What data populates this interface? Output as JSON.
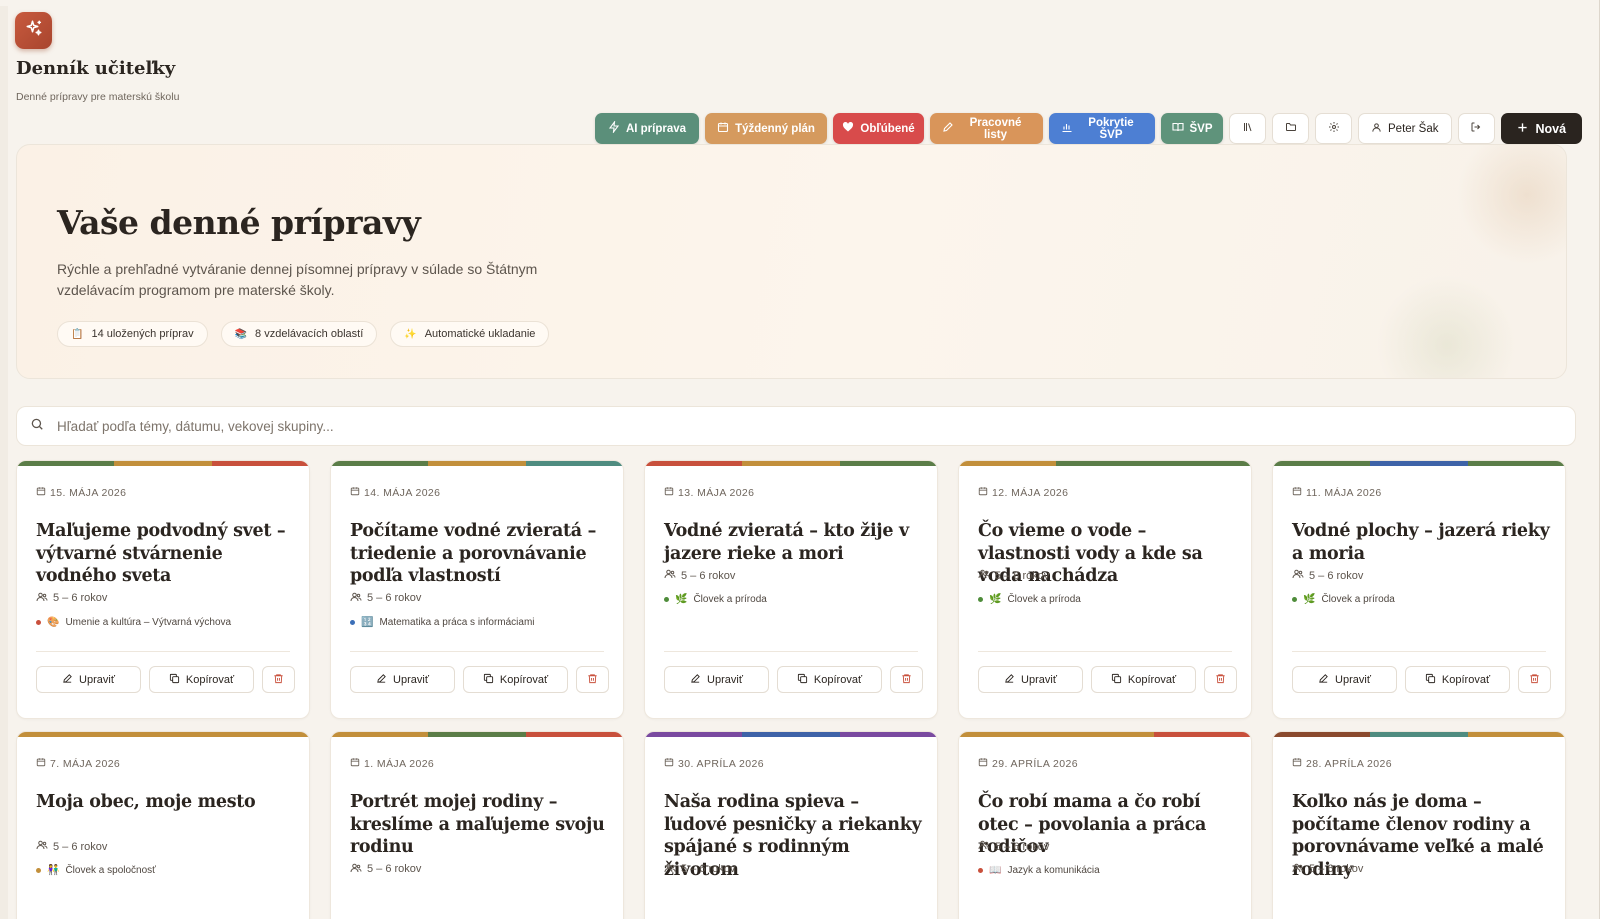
{
  "brand": {
    "title": "Denník učiteľky",
    "subtitle": "Denné prípravy pre materskú školu"
  },
  "toolbar": {
    "buttons": [
      {
        "label": "AI príprava",
        "color": "#5b8f7a",
        "icon": "bolt-icon"
      },
      {
        "label": "Týždenný plán",
        "color": "#d59a5e",
        "icon": "calendar-icon"
      },
      {
        "label": "Obľúbené",
        "color": "#d84b4b",
        "icon": "heart-icon"
      },
      {
        "label": "Pracovné listy",
        "color": "#d9955a",
        "icon": "pencil-icon"
      },
      {
        "label": "Pokrytie ŠVP",
        "color": "#4d7fd3",
        "icon": "bar-chart-icon"
      },
      {
        "label": "ŠVP",
        "color": "#5f937b",
        "icon": "book-icon"
      }
    ],
    "user": "Peter Šak",
    "new_label": "Nová"
  },
  "hero": {
    "title": "Vaše denné prípravy",
    "description": "Rýchle a prehľadné vytváranie dennej písomnej prípravy v súlade so Štátnym vzdelávacím programom pre materské školy.",
    "pills": [
      {
        "icon": "📋",
        "label": "14 uložených príprav"
      },
      {
        "icon": "📚",
        "label": "8 vzdelávacích oblastí"
      },
      {
        "icon": "✨",
        "label": "Automatické ukladanie"
      }
    ]
  },
  "search": {
    "placeholder": "Hľadať podľa témy, dátumu, vekovej skupiny..."
  },
  "card_labels": {
    "edit": "Upraviť",
    "copy": "Kopírovať"
  },
  "cards": [
    {
      "date": "15. MÁJA 2026",
      "title": "Maľujeme podvodný svet – výtvarné stvárnenie vodného sveta",
      "age": "5 – 6 rokov",
      "area_icon": "🎨",
      "area": "Umenie a kultúra – Výtvarná výchova",
      "dot": "#c9503c",
      "stripe": [
        "#5b7d48",
        "#c28f3b",
        "#c8503c"
      ]
    },
    {
      "date": "14. MÁJA 2026",
      "title": "Počítame vodné zvieratá – triedenie a porovnávanie podľa vlastností",
      "age": "5 – 6 rokov",
      "area_icon": "🔢",
      "area": "Matematika a práca s informáciami",
      "dot": "#3c6fb8",
      "stripe": [
        "#5b7d48",
        "#c28f3b",
        "#4f8c80"
      ]
    },
    {
      "date": "13. MÁJA 2026",
      "title": "Vodné zvieratá – kto žije v jazere rieke a mori",
      "age": "5 – 6 rokov",
      "area_icon": "🌿",
      "area": "Človek a príroda",
      "dot": "#4e8c3a",
      "stripe": [
        "#c8503c",
        "#c28f3b",
        "#5b7d48"
      ]
    },
    {
      "date": "12. MÁJA 2026",
      "title": "Čo vieme o vode – vlastnosti vody a kde sa voda nachádza",
      "age": "5 – 6 rokov",
      "area_icon": "🌿",
      "area": "Človek a príroda",
      "dot": "#4e8c3a",
      "stripe": [
        "#c28f3b",
        "#5b7d48",
        "#5b7d48"
      ]
    },
    {
      "date": "11. MÁJA 2026",
      "title": "Vodné plochy – jazerá rieky a moria",
      "age": "5 – 6 rokov",
      "area_icon": "🌿",
      "area": "Človek a príroda",
      "dot": "#4e8c3a",
      "stripe": [
        "#5b7d48",
        "#3e63a8",
        "#5b7d48"
      ]
    },
    {
      "date": "7. MÁJA 2026",
      "title": "Moja obec, moje mesto",
      "age": "5 – 6 rokov",
      "area_icon": "👫",
      "area": "Človek a spoločnosť",
      "dot": "#c28f3b",
      "stripe": [
        "#c28f3b",
        "#c28f3b",
        "#c28f3b"
      ]
    },
    {
      "date": "1. MÁJA 2026",
      "title": "Portrét mojej rodiny – kreslíme a maľujeme svoju rodinu",
      "age": "5 – 6 rokov",
      "area_icon": "",
      "area": "",
      "dot": "#c9503c",
      "stripe": [
        "#c28f3b",
        "#5b7d48",
        "#c8503c"
      ]
    },
    {
      "date": "30. APRÍLA 2026",
      "title": "Naša rodina spieva – ľudové pesničky a riekanky spájané s rodinným životom",
      "age": "5 – 6 rokov",
      "area_icon": "",
      "area": "",
      "dot": "#7a4aa0",
      "stripe": [
        "#7a4aa0",
        "#3e63a8",
        "#7a4aa0"
      ]
    },
    {
      "date": "29. APRÍLA 2026",
      "title": "Čo robí mama a čo robí otec – povolania a práca rodičov",
      "age": "5 – 6 rokov",
      "area_icon": "📖",
      "area": "Jazyk a komunikácia",
      "dot": "#c9503c",
      "stripe": [
        "#c28f3b",
        "#c28f3b",
        "#c8503c"
      ]
    },
    {
      "date": "28. APRÍLA 2026",
      "title": "Koľko nás je doma – počítame členov rodiny a porovnávame veľké a malé rodiny",
      "age": "5 – 6 rokov",
      "area_icon": "",
      "area": "",
      "dot": "#c28f3b",
      "stripe": [
        "#8a4a2e",
        "#4f8c80",
        "#c28f3b"
      ]
    }
  ]
}
